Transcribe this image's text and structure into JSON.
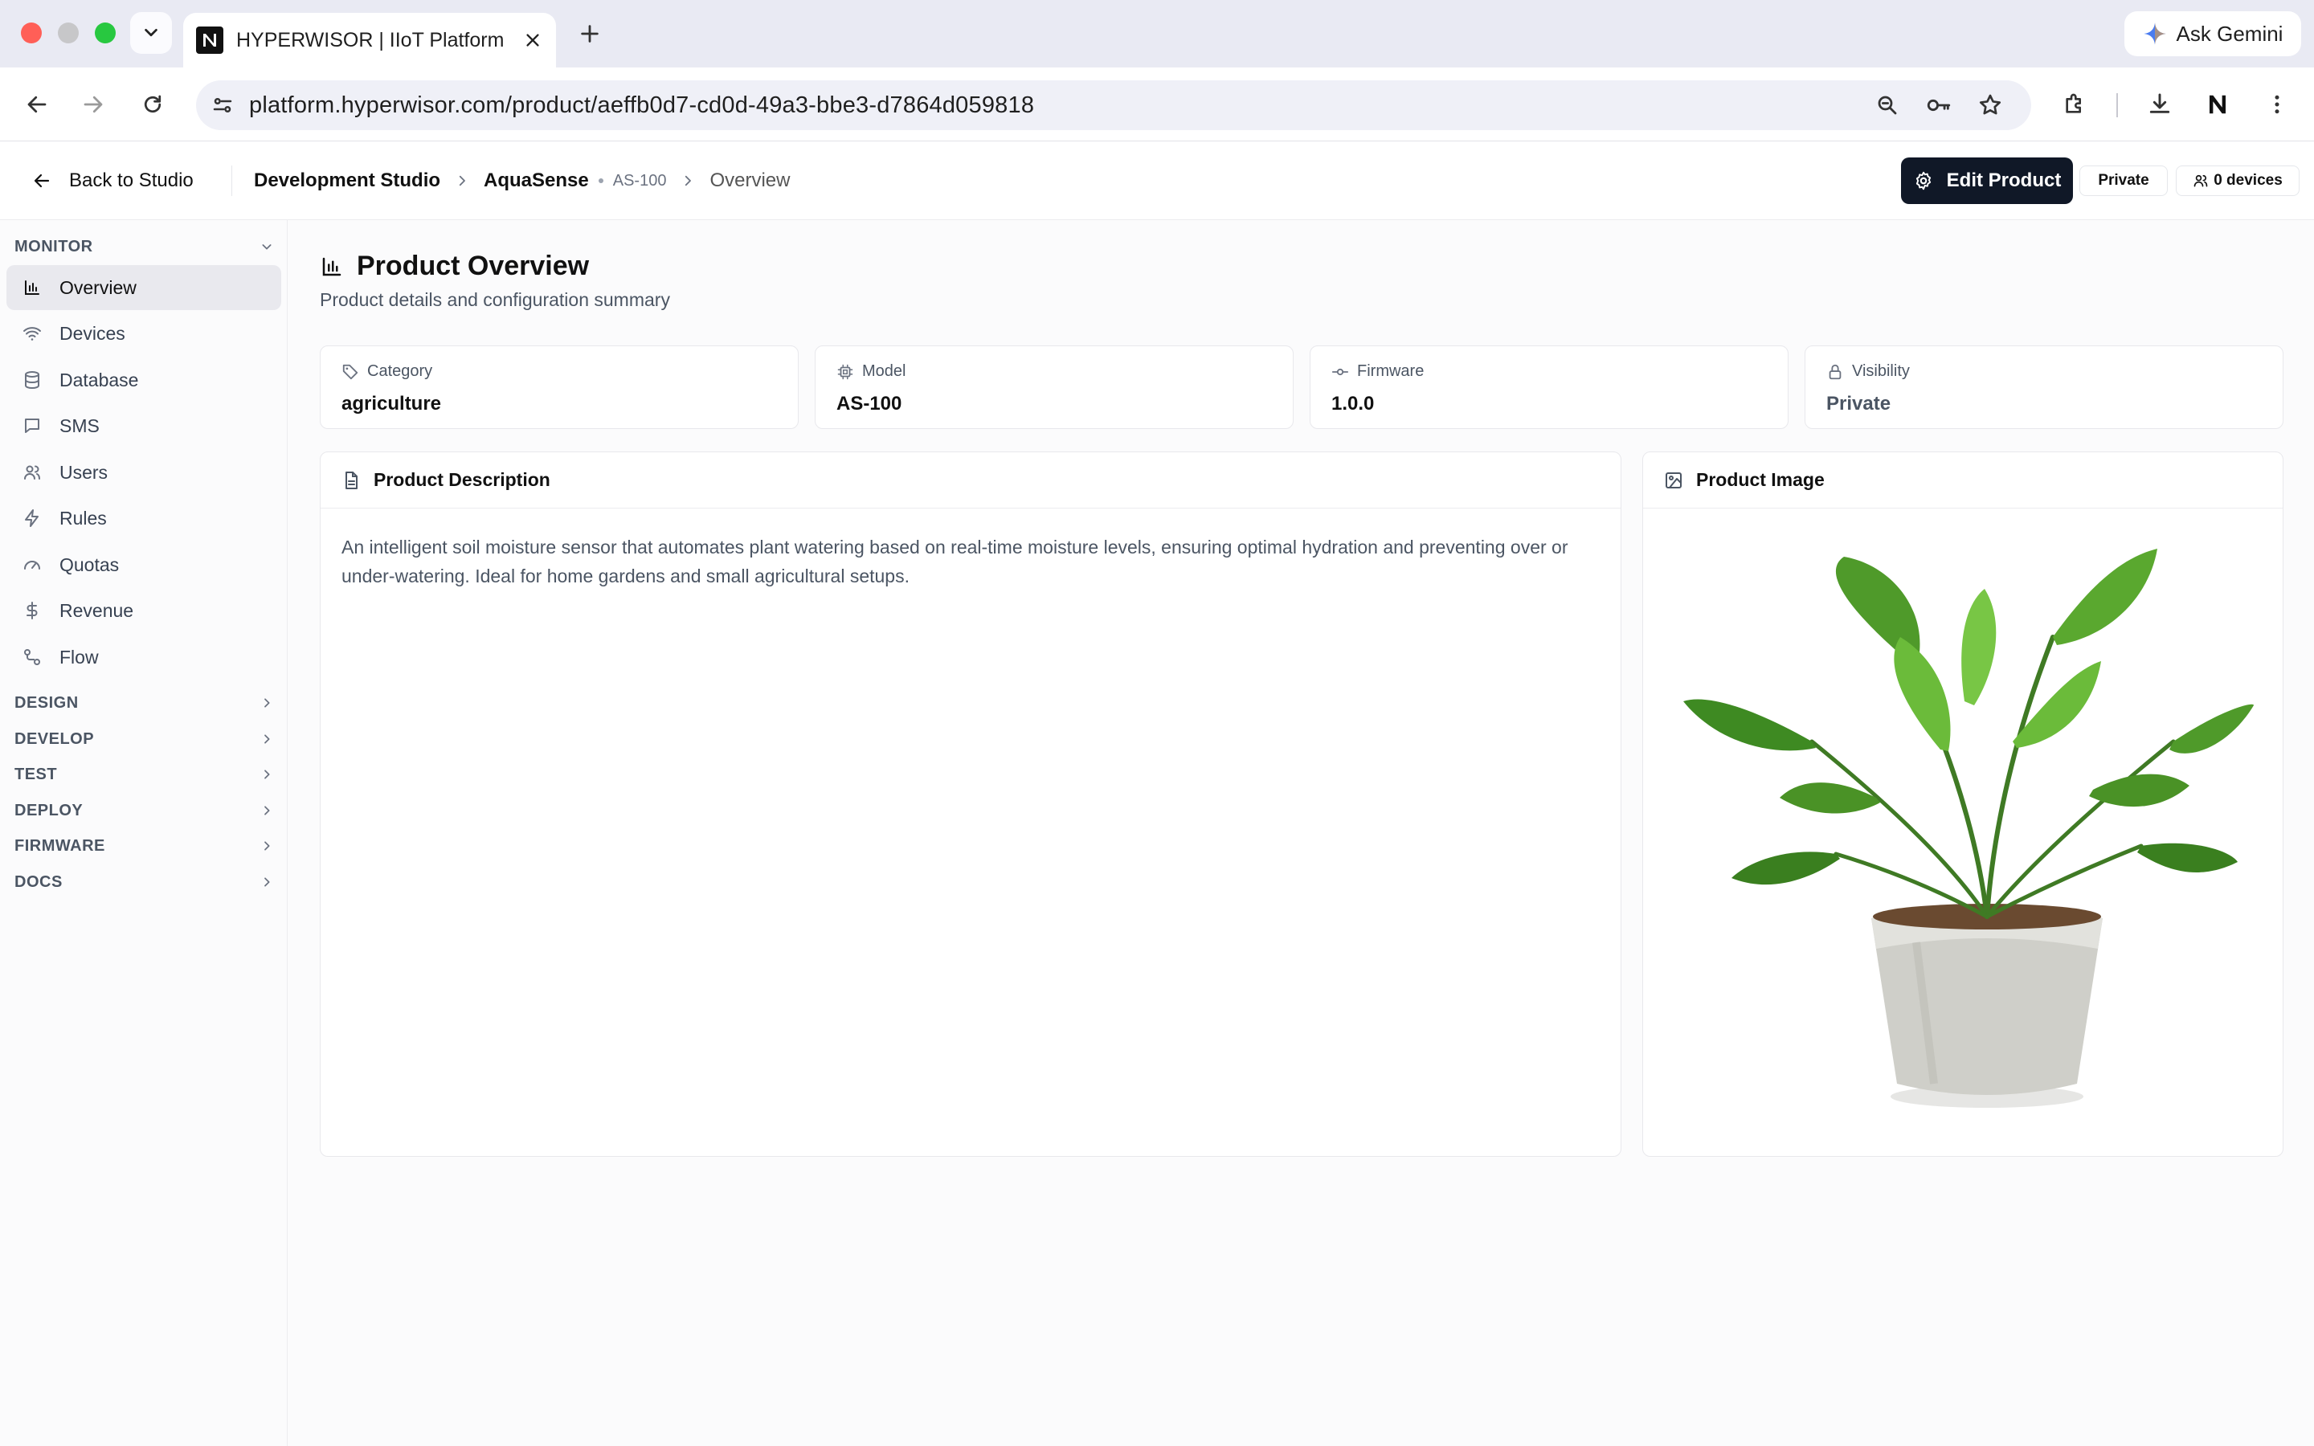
{
  "browser": {
    "tab_title": "HYPERWISOR | IIoT Platform",
    "url": "platform.hyperwisor.com/product/aeffb0d7-cd0d-49a3-bbe3-d7864d059818",
    "ask_gemini": "Ask Gemini"
  },
  "header": {
    "back_label": "Back to Studio",
    "breadcrumb": {
      "studio": "Development Studio",
      "product": "AquaSense",
      "model": "AS-100",
      "page": "Overview"
    },
    "edit_button": "Edit Product",
    "visibility_badge": "Private",
    "devices_badge": "0 devices"
  },
  "sidebar": {
    "monitor_section": "MONITOR",
    "items": [
      {
        "label": "Overview",
        "icon": "bar-chart-icon",
        "active": true
      },
      {
        "label": "Devices",
        "icon": "wifi-icon"
      },
      {
        "label": "Database",
        "icon": "database-icon"
      },
      {
        "label": "SMS",
        "icon": "message-icon"
      },
      {
        "label": "Users",
        "icon": "users-icon"
      },
      {
        "label": "Rules",
        "icon": "zap-icon"
      },
      {
        "label": "Quotas",
        "icon": "gauge-icon"
      },
      {
        "label": "Revenue",
        "icon": "dollar-icon"
      },
      {
        "label": "Flow",
        "icon": "flow-icon"
      }
    ],
    "sections": [
      "DESIGN",
      "DEVELOP",
      "TEST",
      "DEPLOY",
      "FIRMWARE",
      "DOCS"
    ]
  },
  "main": {
    "title": "Product Overview",
    "subtitle": "Product details and configuration summary",
    "cards": [
      {
        "label": "Category",
        "value": "agriculture",
        "icon": "tag-icon"
      },
      {
        "label": "Model",
        "value": "AS-100",
        "icon": "chip-icon"
      },
      {
        "label": "Firmware",
        "value": "1.0.0",
        "icon": "commit-icon"
      },
      {
        "label": "Visibility",
        "value": "Private",
        "icon": "lock-icon"
      }
    ],
    "description_title": "Product Description",
    "description_text": "An intelligent soil moisture sensor that automates plant watering based on real-time moisture levels, ensuring optimal hydration and preventing over or under-watering. Ideal for home gardens and small agricultural setups.",
    "image_title": "Product Image"
  },
  "colors": {
    "accent_dark": "#101827",
    "traffic_red": "#ff5f57",
    "traffic_yellow": "#c7c7c9",
    "traffic_green": "#28c840"
  }
}
